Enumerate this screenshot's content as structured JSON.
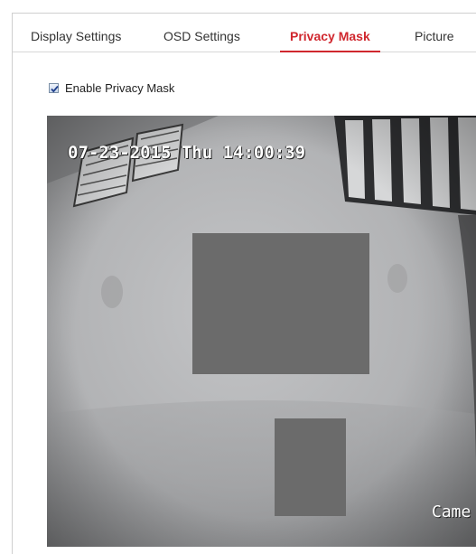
{
  "tabs": [
    {
      "label": "Display Settings",
      "active": false
    },
    {
      "label": "OSD Settings",
      "active": false
    },
    {
      "label": "Privacy Mask",
      "active": true
    },
    {
      "label": "Picture",
      "active": false
    }
  ],
  "privacy": {
    "enable_label": "Enable Privacy Mask",
    "enabled": true
  },
  "video": {
    "osd_datetime": "07-23-2015 Thu 14:00:39",
    "osd_camera_name": "Came"
  },
  "colors": {
    "accent": "#d0272e",
    "mask": "#6b6b6b"
  }
}
